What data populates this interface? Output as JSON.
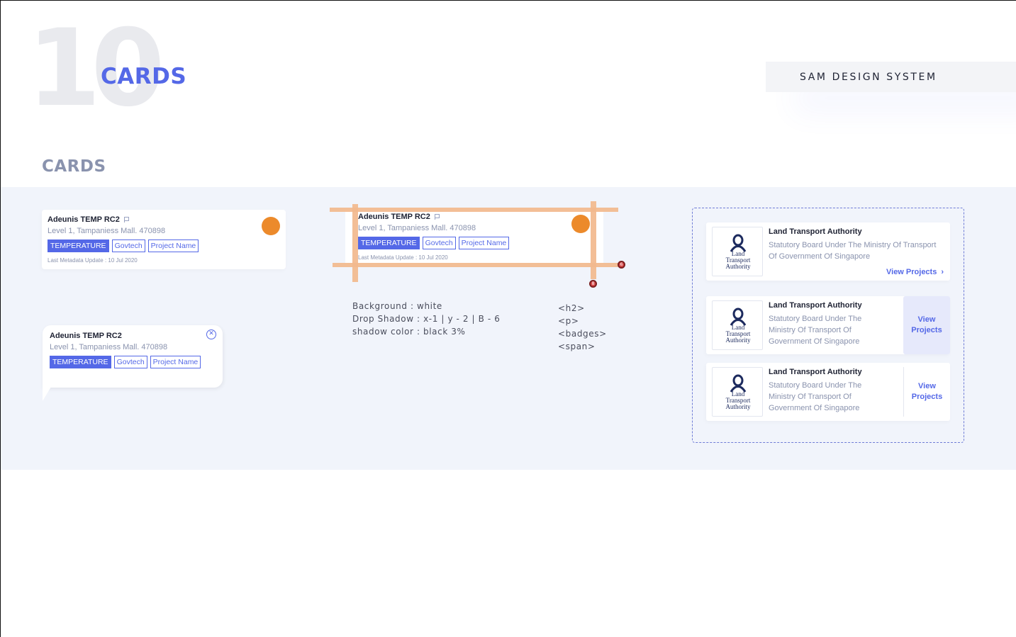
{
  "header": {
    "section_number": "10",
    "title": "CARDS",
    "design_system": "SAM DESIGN SYSTEM"
  },
  "section": {
    "title": "CARDS"
  },
  "colors": {
    "accent": "#5468e7",
    "status_dot": "#ec8a2b",
    "band_bg": "#f1f4fb"
  },
  "card_default": {
    "title": "Adeunis TEMP RC2",
    "title_icon": "flag-icon",
    "subtitle": "Level 1, Tampaniess Mall. 470898",
    "badges": [
      "TEMPERATURE",
      "Govtech",
      "Project Name"
    ],
    "meta": "Last Metadata Update : 10 Jul 2020"
  },
  "card_spec": {
    "title": "Adeunis TEMP RC2",
    "subtitle": "Level 1, Tampaniess Mall. 470898",
    "badges": [
      "TEMPERATURE",
      "Govtech",
      "Project Name"
    ],
    "meta": "Last Metadata Update : 10 Jul 2020",
    "padding_markers": [
      "6",
      "8"
    ],
    "notes": [
      "Background : white",
      "Drop Shadow : x-1 | y - 2 | B - 6",
      "shadow color : black 3%"
    ],
    "tags": [
      "<h2>",
      "<p>",
      "<badges>",
      "<span>"
    ]
  },
  "card_tooltip": {
    "title": "Adeunis TEMP RC2",
    "subtitle": "Level 1, Tampaniess Mall. 470898",
    "badges": [
      "TEMPERATURE",
      "Govtech",
      "Project Name"
    ],
    "close_icon": "close-circle-icon"
  },
  "org_cards": [
    {
      "logo_text": [
        "Land",
        "Transport",
        "Authority"
      ],
      "name": "Land Transport Authority",
      "desc_lines": [
        "Statutory Board Under The Ministry Of Transport",
        "Of Government Of Singapore"
      ],
      "action": "View Projects",
      "action_icon": "chevron-right-icon"
    },
    {
      "logo_text": [
        "Land",
        "Transport",
        "Authority"
      ],
      "name": "Land Transport Authority",
      "desc_lines": [
        "Statutory Board Under The",
        "Ministry Of Transport Of",
        "Government Of Singapore"
      ],
      "action_lines": [
        "View",
        "Projects"
      ]
    },
    {
      "logo_text": [
        "Land",
        "Transport",
        "Authority"
      ],
      "name": "Land Transport Authority",
      "desc_lines": [
        "Statutory Board Under The",
        "Ministry Of Transport Of",
        "Government Of Singapore"
      ],
      "action_lines": [
        "View",
        "Projects"
      ]
    }
  ]
}
